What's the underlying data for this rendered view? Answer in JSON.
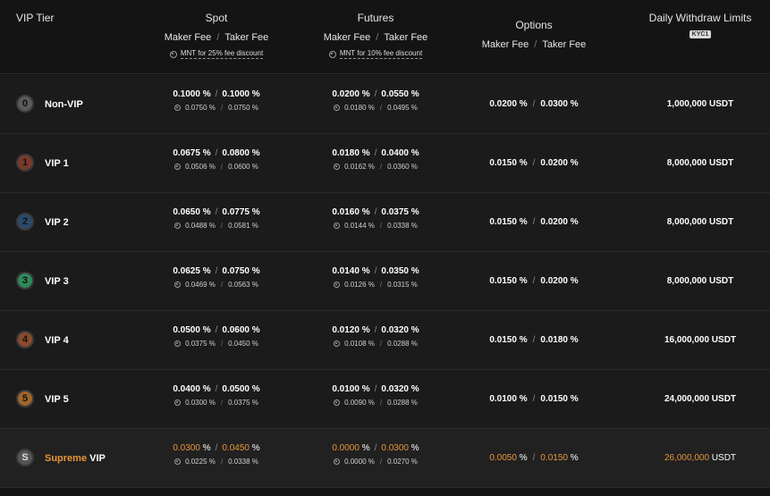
{
  "header": {
    "vip_tier": "VIP Tier",
    "spot": {
      "title": "Spot",
      "maker": "Maker Fee",
      "sep": "/",
      "taker": "Taker Fee",
      "discount": "MNT for 25% fee discount"
    },
    "futures": {
      "title": "Futures",
      "maker": "Maker Fee",
      "sep": "/",
      "taker": "Taker Fee",
      "discount": "MNT for 10% fee discount"
    },
    "options": {
      "title": "Options",
      "maker": "Maker Fee",
      "sep": "/",
      "taker": "Taker Fee"
    },
    "limits": {
      "title": "Daily Withdraw Limits",
      "badge": "KYC1"
    }
  },
  "colors": {
    "accent_orange": "#e8953a",
    "background": "#141414",
    "row": "#1b1b1b"
  },
  "rows": [
    {
      "badge": "0",
      "badge_color": "#5a5a5a",
      "name": "Non-VIP",
      "spot_maker": "0.1000 %",
      "spot_taker": "0.1000 %",
      "spot_maker_disc": "0.0750 %",
      "spot_taker_disc": "0.0750 %",
      "fut_maker": "0.0200 %",
      "fut_taker": "0.0550 %",
      "fut_maker_disc": "0.0180 %",
      "fut_taker_disc": "0.0495 %",
      "opt_maker": "0.0200 %",
      "opt_taker": "0.0300 %",
      "limit": "1,000,000 USDT"
    },
    {
      "badge": "1",
      "badge_color": "#7a3a2a",
      "name": "VIP 1",
      "spot_maker": "0.0675 %",
      "spot_taker": "0.0800 %",
      "spot_maker_disc": "0.0506 %",
      "spot_taker_disc": "0.0600 %",
      "fut_maker": "0.0180 %",
      "fut_taker": "0.0400 %",
      "fut_maker_disc": "0.0162 %",
      "fut_taker_disc": "0.0360 %",
      "opt_maker": "0.0150 %",
      "opt_taker": "0.0200 %",
      "limit": "8,000,000 USDT"
    },
    {
      "badge": "2",
      "badge_color": "#2c4a6a",
      "name": "VIP 2",
      "spot_maker": "0.0650 %",
      "spot_taker": "0.0775 %",
      "spot_maker_disc": "0.0488 %",
      "spot_taker_disc": "0.0581 %",
      "fut_maker": "0.0160 %",
      "fut_taker": "0.0375 %",
      "fut_maker_disc": "0.0144 %",
      "fut_taker_disc": "0.0338 %",
      "opt_maker": "0.0150 %",
      "opt_taker": "0.0200 %",
      "limit": "8,000,000 USDT"
    },
    {
      "badge": "3",
      "badge_color": "#2e8a5a",
      "name": "VIP 3",
      "spot_maker": "0.0625 %",
      "spot_taker": "0.0750 %",
      "spot_maker_disc": "0.0469 %",
      "spot_taker_disc": "0.0563 %",
      "fut_maker": "0.0140 %",
      "fut_taker": "0.0350 %",
      "fut_maker_disc": "0.0126 %",
      "fut_taker_disc": "0.0315 %",
      "opt_maker": "0.0150 %",
      "opt_taker": "0.0200 %",
      "limit": "8,000,000 USDT"
    },
    {
      "badge": "4",
      "badge_color": "#8a4a2a",
      "name": "VIP 4",
      "spot_maker": "0.0500 %",
      "spot_taker": "0.0600 %",
      "spot_maker_disc": "0.0375 %",
      "spot_taker_disc": "0.0450 %",
      "fut_maker": "0.0120 %",
      "fut_taker": "0.0320 %",
      "fut_maker_disc": "0.0108 %",
      "fut_taker_disc": "0.0288 %",
      "opt_maker": "0.0150 %",
      "opt_taker": "0.0180 %",
      "limit": "16,000,000 USDT"
    },
    {
      "badge": "5",
      "badge_color": "#a0652a",
      "name": "VIP 5",
      "spot_maker": "0.0400 %",
      "spot_taker": "0.0500 %",
      "spot_maker_disc": "0.0300 %",
      "spot_taker_disc": "0.0375 %",
      "fut_maker": "0.0100 %",
      "fut_taker": "0.0320 %",
      "fut_maker_disc": "0.0090 %",
      "fut_taker_disc": "0.0288 %",
      "opt_maker": "0.0100 %",
      "opt_taker": "0.0150 %",
      "limit": "24,000,000 USDT"
    }
  ],
  "supreme": {
    "badge": "S",
    "badge_color": "#555555",
    "name_accent": "Supreme",
    "name_rest": "VIP",
    "spot_maker": "0.0300",
    "spot_taker": "0.0450",
    "spot_maker_disc": "0.0225 %",
    "spot_taker_disc": "0.0338 %",
    "fut_maker": "0.0000",
    "fut_taker": "0.0300",
    "fut_maker_disc": "0.0000 %",
    "fut_taker_disc": "0.0270 %",
    "opt_maker": "0.0050",
    "opt_taker": "0.0150",
    "pct": "%",
    "limit_num": "26,000,000",
    "limit_unit": "USDT"
  }
}
